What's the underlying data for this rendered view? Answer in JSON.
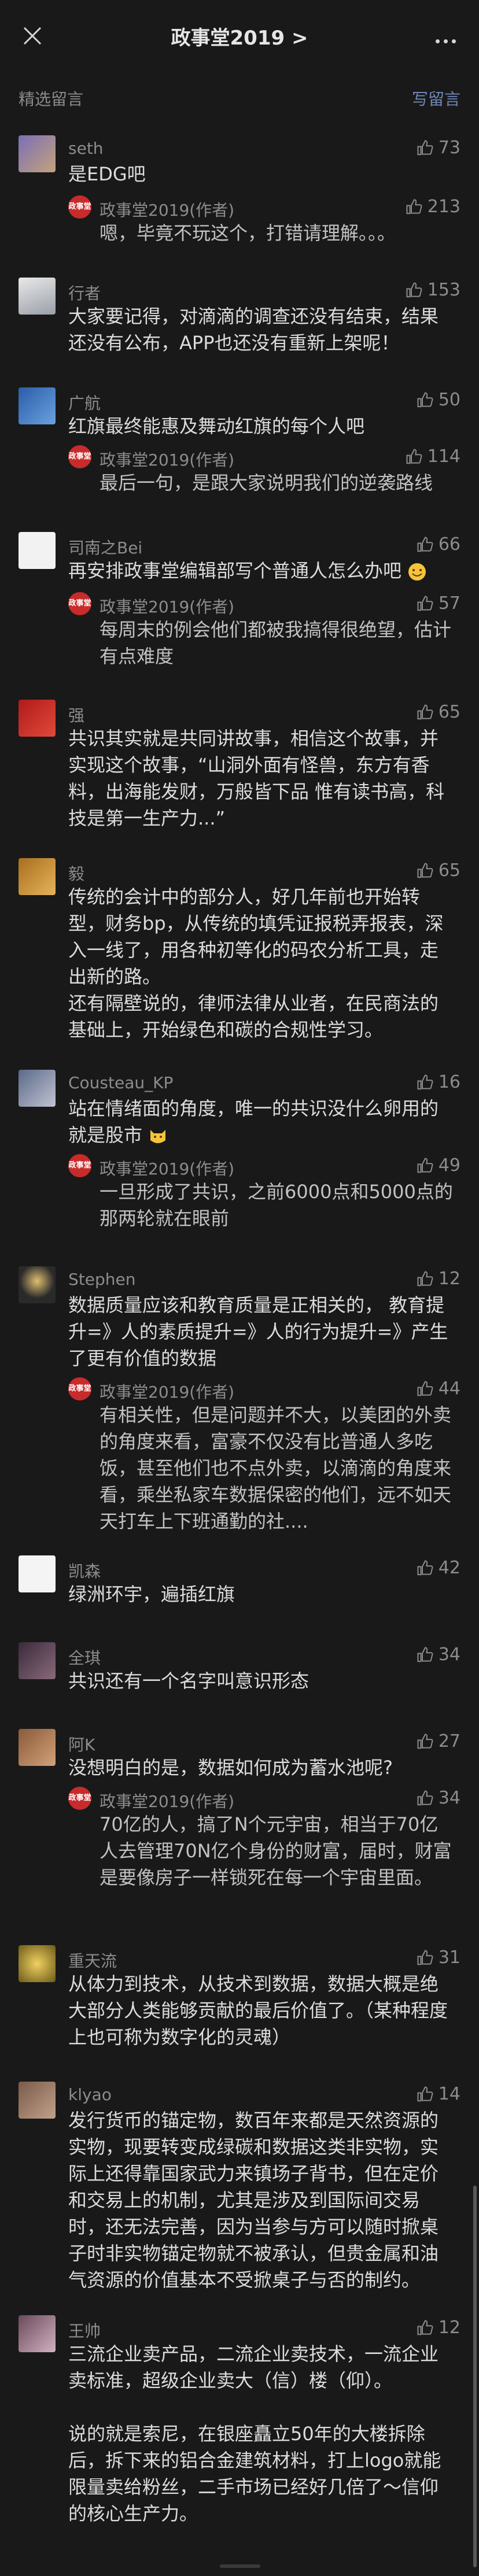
{
  "header": {
    "title": "政事堂2019 >",
    "close_icon": "close-icon",
    "more_icon": "more-icon"
  },
  "subhead": {
    "label": "精选留言",
    "write": "写留言"
  },
  "brand_red": "#c82b2b",
  "comments": [
    {
      "name": "seth",
      "likes": "73",
      "text": "是EDG吧",
      "reply": {
        "name": "政事堂2019(作者)",
        "likes": "213",
        "text": "嗯，毕竟不玩这个，打错请理解。。。"
      }
    },
    {
      "name": "行者",
      "likes": "153",
      "text": "大家要记得，对滴滴的调查还没有结束，结果还没有公布，APP也还没有重新上架呢！"
    },
    {
      "name": "广航",
      "likes": "50",
      "text": "红旗最终能惠及舞动红旗的每个人吧",
      "reply": {
        "name": "政事堂2019(作者)",
        "likes": "114",
        "text": "最后一句，是跟大家说明我们的逆袭路线"
      }
    },
    {
      "name": "司南之Bei",
      "likes": "66",
      "text": "再安排政事堂编辑部写个普通人怎么办吧",
      "reply": {
        "name": "政事堂2019(作者)",
        "likes": "57",
        "text": "每周末的例会他们都被我搞得很绝望，估计有点难度"
      }
    },
    {
      "name": "强",
      "likes": "65",
      "text": "共识其实就是共同讲故事，相信这个故事，并实现这个故事，“山洞外面有怪兽，东方有香料，出海能发财，万般皆下品 惟有读书高，科技是第一生产力...”"
    },
    {
      "name": "毅",
      "likes": "65",
      "text": "传统的会计中的部分人，好几年前也开始转型，财务bp，从传统的填凭证报税弄报表，深入一线了，用各种初等化的码农分析工具，走出新的路。\n还有隔壁说的，律师法律从业者，在民商法的基础上，开始绿色和碳的合规性学习。"
    },
    {
      "name": "Cousteau_KP",
      "likes": "16",
      "text": "站在情绪面的角度，唯一的共识没什么卵用的就是股市",
      "reply": {
        "name": "政事堂2019(作者)",
        "likes": "49",
        "text": "一旦形成了共识，之前6000点和5000点的那两轮就在眼前"
      }
    },
    {
      "name": "Stephen",
      "likes": "12",
      "text": "数据质量应该和教育质量是正相关的， 教育提升=》人的素质提升=》人的行为提升=》产生了更有价值的数据",
      "reply": {
        "name": "政事堂2019(作者)",
        "likes": "44",
        "text": "有相关性，但是问题并不大，以美团的外卖的角度来看，富豪不仅没有比普通人多吃饭，甚至他们也不点外卖，以滴滴的角度来看，乘坐私家车数据保密的他们，远不如天天打车上下班通勤的社...."
      }
    },
    {
      "name": "凯森",
      "likes": "42",
      "text": "绿洲环宇，遍插红旗"
    },
    {
      "name": "全琪",
      "likes": "34",
      "text": "共识还有一个名字叫意识形态"
    },
    {
      "name": "阿K",
      "likes": "27",
      "text": "没想明白的是，数据如何成为蓄水池呢?",
      "reply": {
        "name": "政事堂2019(作者)",
        "likes": "34",
        "text": "70亿的人，搞了N个元宇宙，相当于70亿人去管理70N亿个身份的财富，届时，财富是要像房子一样锁死在每一个宇宙里面。"
      }
    },
    {
      "name": "重天流",
      "likes": "31",
      "text": "从体力到技术，从技术到数据，数据大概是绝大部分人类能够贡献的最后价值了。（某种程度上也可称为数字化的灵魂）"
    },
    {
      "name": "klyao",
      "likes": "14",
      "text": "发行货币的锚定物，数百年来都是天然资源的实物，现要转变成绿碳和数据这类非实物，实际上还得靠国家武力来镇场子背书，但在定价和交易上的机制，尤其是涉及到国际间交易时，还无法完善，因为当参与方可以随时掀桌子时非实物锚定物就不被承认，但贵金属和油气资源的价值基本不受掀桌子与否的制约。"
    },
    {
      "name": "王帅",
      "likes": "12",
      "text": "三流企业卖产品，二流企业卖技术，一流企业卖标准，超级企业卖大（信）楼（仰）。\n\n说的就是索尼，在银座矗立50年的大楼拆除后，拆下来的铝合金建筑材料，打上logo就能限量卖给粉丝，二手市场已经好几倍了～信仰的核心生产力。"
    }
  ]
}
